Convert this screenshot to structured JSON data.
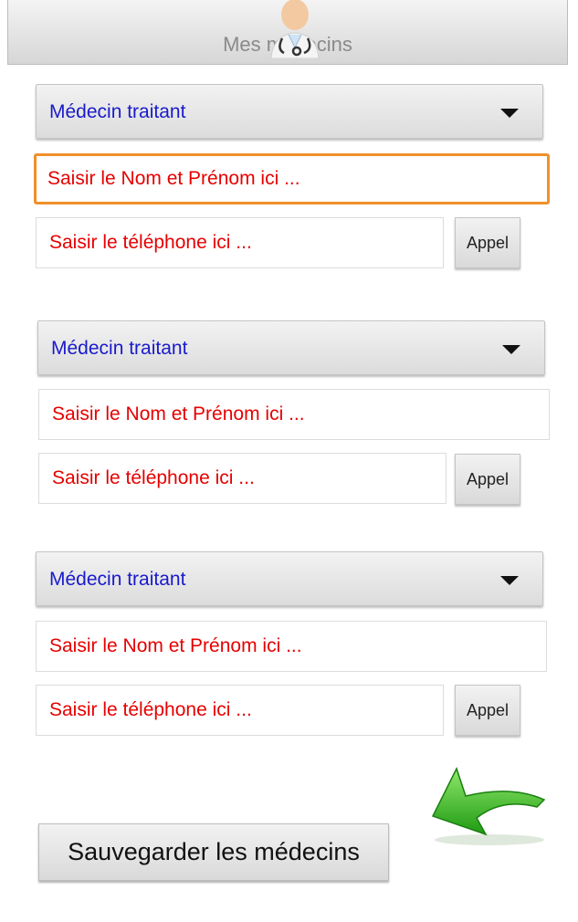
{
  "header": {
    "title": "Mes médecins",
    "avatar_icon": "doctor-avatar-icon"
  },
  "doctors": [
    {
      "role_selected": "Médecin traitant",
      "name_placeholder": "Saisir le Nom et Prénom ici ...",
      "phone_placeholder": "Saisir le téléphone ici ...",
      "call_label": "Appel"
    },
    {
      "role_selected": "Médecin traitant",
      "name_placeholder": "Saisir le Nom et Prénom ici ...",
      "phone_placeholder": "Saisir le téléphone ici ...",
      "call_label": "Appel"
    },
    {
      "role_selected": "Médecin traitant",
      "name_placeholder": "Saisir le Nom et Prénom ici ...",
      "phone_placeholder": "Saisir le téléphone ici ...",
      "call_label": "Appel"
    }
  ],
  "actions": {
    "save_label": "Sauvegarder les médecins",
    "back_icon": "back-arrow-icon"
  },
  "colors": {
    "spinner_text": "#1a1acc",
    "placeholder_text": "#e60000",
    "focus_border": "#f0902a",
    "back_arrow": "#3cc21e"
  }
}
